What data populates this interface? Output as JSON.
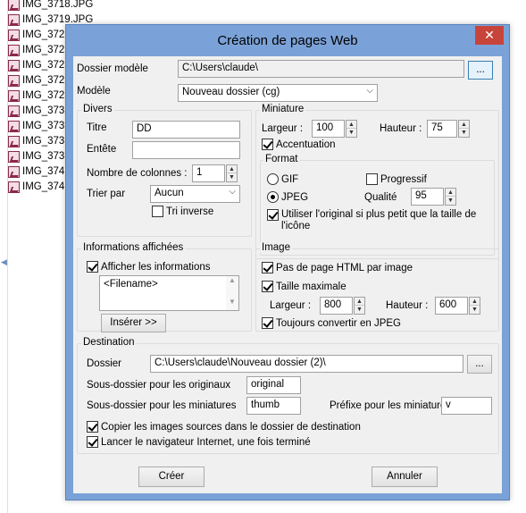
{
  "file_list": [
    "IMG_3718.JPG",
    "IMG_3719.JPG",
    "IMG_372",
    "IMG_372",
    "IMG_372",
    "IMG_372",
    "IMG_372",
    "IMG_373",
    "IMG_373",
    "IMG_373",
    "IMG_373",
    "IMG_374",
    "IMG_374"
  ],
  "window": {
    "title": "Création de pages Web",
    "close": "✕"
  },
  "dossier_modele": {
    "label": "Dossier modèle",
    "value": "C:\\Users\\claude\\",
    "browse": "..."
  },
  "modele": {
    "label": "Modèle",
    "value": "Nouveau dossier (cg)"
  },
  "divers": {
    "title": "Divers",
    "titre_label": "Titre",
    "titre_value": "DD",
    "entete_label": "Entête",
    "entete_value": "",
    "colonnes_label": "Nombre de colonnes :",
    "colonnes_value": "1",
    "trier_label": "Trier par",
    "trier_value": "Aucun",
    "tri_inverse": "Tri inverse"
  },
  "miniature": {
    "title": "Miniature",
    "largeur_label": "Largeur :",
    "largeur_value": "100",
    "hauteur_label": "Hauteur :",
    "hauteur_value": "75",
    "accentuation": "Accentuation",
    "format_title": "Format",
    "gif": "GIF",
    "progressif": "Progressif",
    "jpeg": "JPEG",
    "qualite_label": "Qualité",
    "qualite_value": "95",
    "utiliser_original_line1": "Utiliser l'original si plus petit que la taille de",
    "utiliser_original_line2": "l'icône"
  },
  "infos": {
    "title": "Informations affichées",
    "afficher": "Afficher les informations",
    "textarea": "<Filename>",
    "inserer": "Insérer >>"
  },
  "image": {
    "title": "Image",
    "pas_de_page": "Pas de page HTML par image",
    "taille_max": "Taille maximale",
    "largeur_label": "Largeur :",
    "largeur_value": "800",
    "hauteur_label": "Hauteur :",
    "hauteur_value": "600",
    "toujours_jpeg": "Toujours convertir en JPEG"
  },
  "destination": {
    "title": "Destination",
    "dossier_label": "Dossier",
    "dossier_value": "C:\\Users\\claude\\Nouveau dossier (2)\\",
    "browse": "...",
    "sous_orig_label": "Sous-dossier pour les originaux",
    "sous_orig_value": "original",
    "sous_mini_label": "Sous-dossier pour les miniatures",
    "sous_mini_value": "thumb",
    "prefixe_label": "Préfixe pour les miniatures",
    "prefixe_value": "v",
    "copier": "Copier les images sources dans le dossier de destination",
    "lancer": "Lancer le navigateur Internet, une fois terminé"
  },
  "buttons": {
    "creer": "Créer",
    "annuler": "Annuler"
  },
  "icons": {
    "file": "image-file-icon",
    "check": "checkmark-icon",
    "spin_up": "spin-up-icon",
    "spin_down": "spin-down-icon",
    "dropdown": "chevron-down-icon"
  }
}
